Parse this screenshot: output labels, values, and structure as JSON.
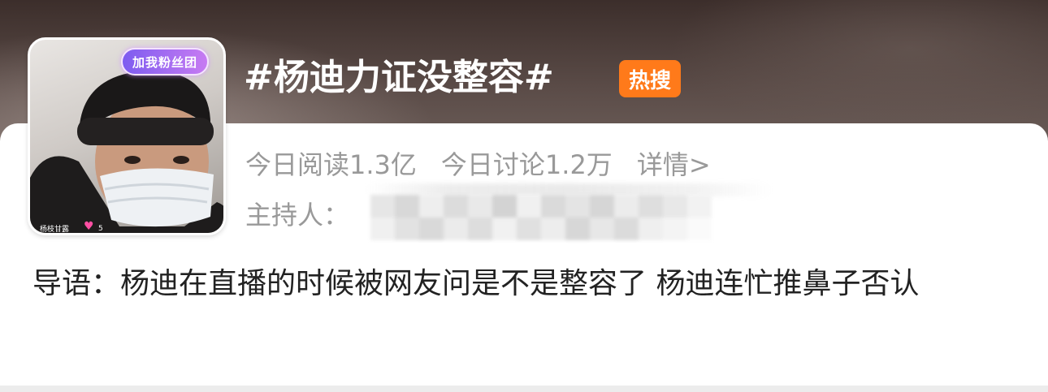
{
  "topic": {
    "title": "#杨迪力证没整容#",
    "hot_badge": "热搜",
    "hot_badge_color": "#ff7a1a"
  },
  "stats": {
    "read": "今日阅读1.3亿",
    "discuss": "今日讨论1.2万",
    "detail_link": "详情>"
  },
  "host": {
    "label": "主持人："
  },
  "avatar": {
    "fan_badge": "加我粉丝团",
    "caption": "杨枝甘露",
    "level": "5"
  },
  "intro": {
    "text": "导语：杨迪在直播的时候被网友问是不是整容了 杨迪连忙推鼻子否认"
  }
}
